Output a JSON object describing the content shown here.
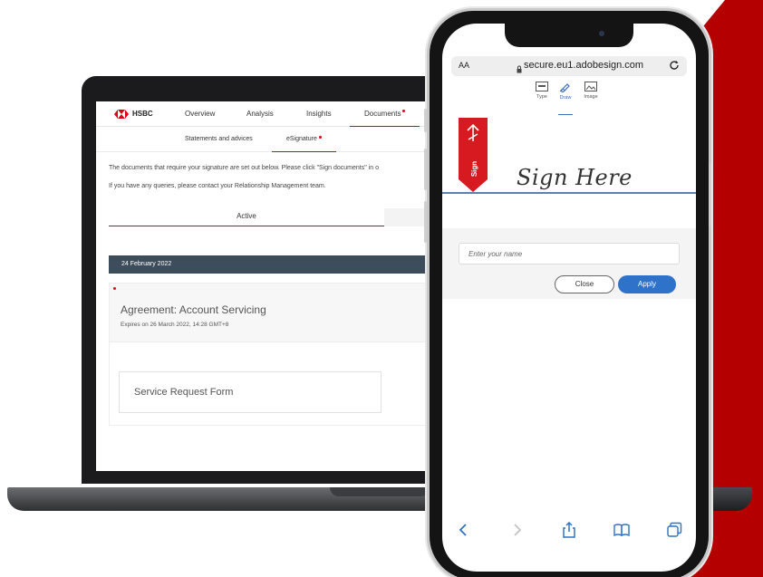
{
  "laptop": {
    "brand": "HSBC",
    "nav": [
      "Overview",
      "Analysis",
      "Insights",
      "Documents"
    ],
    "sub_nav": [
      "Statements and advices",
      "eSignature"
    ],
    "intro_line1": "The documents that require your signature are set out below. Please click \"Sign documents\" in o",
    "intro_line2": "If you have any queries, please contact your Relationship Management team.",
    "tab_active": "Active",
    "date": "24 February 2022",
    "agreement_title": "Agreement: Account Servicing",
    "agreement_expiry": "Expires on 26 March 2022, 14:28 GMT+8",
    "service_form": "Service Request Form"
  },
  "phone": {
    "text_size_label": "AA",
    "url": "secure.eu1.adobesign.com",
    "signature_tabs": [
      "Type",
      "Draw",
      "Image"
    ],
    "active_tab": "Draw",
    "sign_here": "Sign Here",
    "flag_text": "Sign",
    "name_placeholder": "Enter your name",
    "close_label": "Close",
    "apply_label": "Apply"
  },
  "colors": {
    "hsbc_red": "#db0011",
    "date_bar": "#3d4d5c",
    "apply_blue": "#2f72c9",
    "background_red": "#b50000"
  },
  "icons": {
    "browser_toolbar": [
      "back-icon",
      "forward-icon",
      "share-icon",
      "bookmarks-icon",
      "tabs-icon"
    ]
  }
}
